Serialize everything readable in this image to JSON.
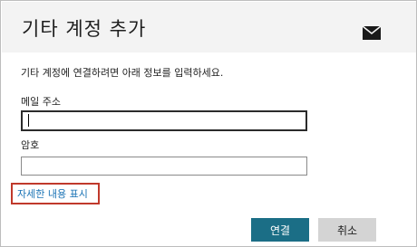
{
  "dialog": {
    "title": "기타 계정 추가",
    "icon": "mail-icon",
    "instruction": "기타 계정에 연결하려면 아래 정보를 입력하세요."
  },
  "form": {
    "email_label": "메일 주소",
    "email_value": "",
    "password_label": "암호",
    "password_value": "",
    "show_more_link": "자세한 내용 표시"
  },
  "buttons": {
    "connect_label": "연결",
    "cancel_label": "취소"
  },
  "colors": {
    "accent": "#1b6e86",
    "link": "#1a73b5",
    "highlight_box": "#c0392b"
  }
}
